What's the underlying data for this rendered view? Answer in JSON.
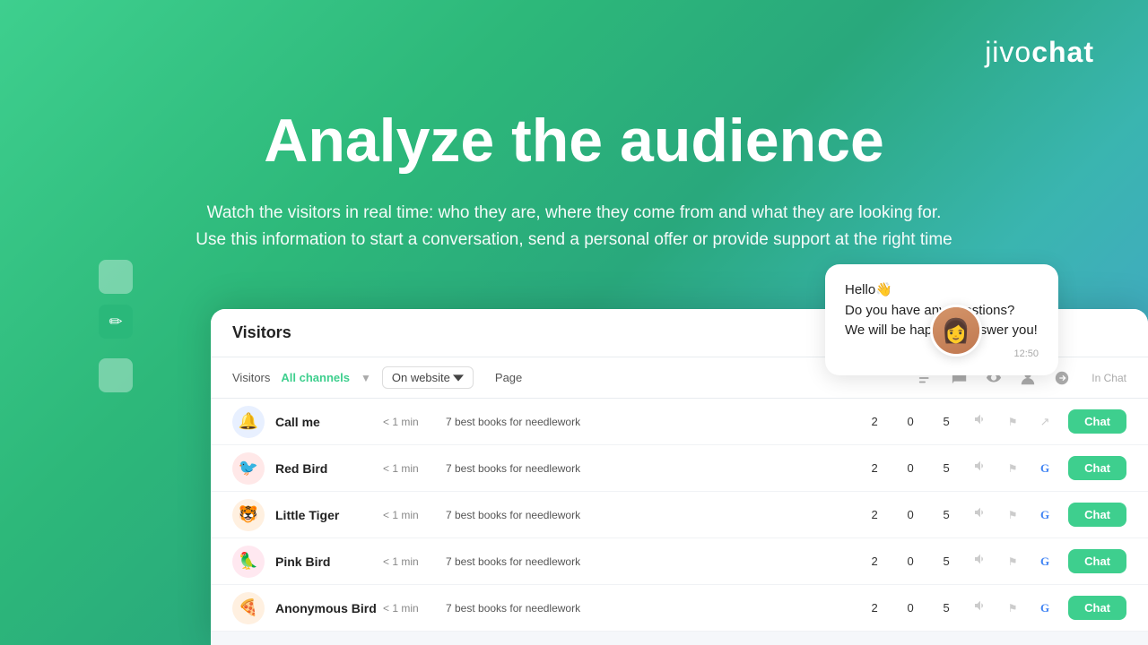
{
  "logo": {
    "jivo": "jivo",
    "chat": "chat"
  },
  "hero": {
    "title": "Analyze the audience",
    "subtitle_line1": "Watch the visitors in real time: who they are, where they come from and what they are looking for.",
    "subtitle_line2": "Use this information to start a conversation, send a personal offer or provide support at the right time"
  },
  "chat_bubble": {
    "greeting": "Hello👋",
    "line1": "Do you have any questions?",
    "line2": "We will be happy to answer you!",
    "time": "12:50"
  },
  "window": {
    "title": "Visitors",
    "toolbar": {
      "visitors_label": "Visitors",
      "all_channels": "All channels",
      "on_website": "On website",
      "page_label": "Page",
      "in_chat_label": "In Chat"
    }
  },
  "visitors": [
    {
      "name": "Call me",
      "time": "< 1 min",
      "page": "7 best books for needlework",
      "stat1": "2",
      "stat2": "0",
      "stat3": "5",
      "source": "direct",
      "avatar": "🔔",
      "avatar_bg": "#e8f0ff",
      "chat_label": "Chat"
    },
    {
      "name": "Red Bird",
      "time": "< 1 min",
      "page": "7 best books for needlework",
      "stat1": "2",
      "stat2": "0",
      "stat3": "5",
      "source": "google",
      "avatar": "🐦",
      "avatar_bg": "#ffe8e8",
      "chat_label": "Chat"
    },
    {
      "name": "Little Tiger",
      "time": "< 1 min",
      "page": "7 best books for needlework",
      "stat1": "2",
      "stat2": "0",
      "stat3": "5",
      "source": "google",
      "avatar": "🐯",
      "avatar_bg": "#fff0e0",
      "chat_label": "Chat"
    },
    {
      "name": "Pink Bird",
      "time": "< 1 min",
      "page": "7 best books for needlework",
      "stat1": "2",
      "stat2": "0",
      "stat3": "5",
      "source": "google",
      "avatar": "🦜",
      "avatar_bg": "#ffe8f0",
      "chat_label": "Chat"
    },
    {
      "name": "Anonymous Bird",
      "time": "< 1 min",
      "page": "7 best books for needlework",
      "stat1": "2",
      "stat2": "0",
      "stat3": "5",
      "source": "google",
      "avatar": "🍕",
      "avatar_bg": "#fff0e0",
      "chat_label": "Chat"
    }
  ]
}
